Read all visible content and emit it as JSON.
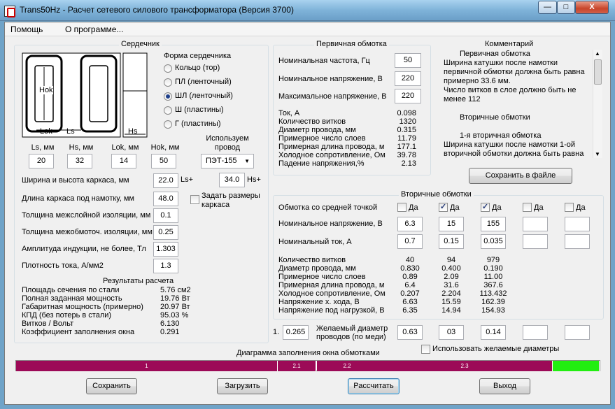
{
  "window": {
    "title": "Trans50Hz - Расчет сетевого силового трансформатора (Версия 3700)",
    "btn_min": "—",
    "btn_max": "□",
    "btn_close": "X"
  },
  "menu": {
    "help": "Помощь",
    "about": "О программе..."
  },
  "core": {
    "group_title": "Сердечник",
    "drawing": {
      "hok": "Hok",
      "lok": "Lok",
      "ls": "Ls",
      "hs": "Hs"
    },
    "shape_title": "Форма сердечника",
    "shapes": [
      {
        "label": "Кольцо  (тор)",
        "selected": false
      },
      {
        "label": "ПЛ  (ленточный)",
        "selected": false
      },
      {
        "label": "ШЛ  (ленточный)",
        "selected": true
      },
      {
        "label": "Ш  (пластины)",
        "selected": false
      },
      {
        "label": "Г (пластины)",
        "selected": false
      }
    ],
    "dims": [
      {
        "label": "Ls, мм",
        "value": "20"
      },
      {
        "label": "Hs, мм",
        "value": "32"
      },
      {
        "label": "Lok, мм",
        "value": "14"
      },
      {
        "label": "Hok, мм",
        "value": "50"
      }
    ],
    "wire_label": "Используем провод",
    "wire_value": "ПЭТ-155",
    "params": [
      {
        "label": "Ширина и высота каркаса, мм",
        "value": "22.0"
      },
      {
        "label": "Длина каркаса под намотку, мм",
        "value": "48.0"
      },
      {
        "label": "Толщина межслойной изоляции, мм",
        "value": "0.1"
      },
      {
        "label": "Толщина межобмоточ. изоляции, мм",
        "value": "0.25"
      },
      {
        "label": "Амплитуда индукции, не более, Тл",
        "value": "1.303"
      },
      {
        "label": "Плотность тока, А/мм2",
        "value": "1.3"
      }
    ],
    "ls_plus": "Ls+",
    "hs_value": "34.0",
    "hs_plus": "Hs+",
    "set_frame_label": "Задать размеры каркаса",
    "results_title": "Результаты расчета",
    "results": [
      {
        "label": "Площадь сечения по стали",
        "value": "5.76 см2"
      },
      {
        "label": "Полная заданная мощность",
        "value": "19.76 Вт"
      },
      {
        "label": "Габаритная мощность (примерно)",
        "value": "20.97 Вт"
      },
      {
        "label": "КПД (без потерь в стали)",
        "value": "95.03 %"
      },
      {
        "label": "Витков / Вольт",
        "value": "6.130"
      },
      {
        "label": "Коэффициент заполнения окна",
        "value": "0.291"
      }
    ]
  },
  "primary": {
    "group_title": "Первичная обмотка",
    "inputs": [
      {
        "label": "Номинальная частота, Гц",
        "value": "50"
      },
      {
        "label": "Номинальное напряжение, В",
        "value": "220"
      },
      {
        "label": "Максимальное напряжение, В",
        "value": "220"
      }
    ],
    "results": [
      {
        "label": "Ток, А",
        "value": "0.098"
      },
      {
        "label": "Количество витков",
        "value": "1320"
      },
      {
        "label": "Диаметр провода, мм",
        "value": "0.315"
      },
      {
        "label": "Примерное число слоев",
        "value": "11.79"
      },
      {
        "label": "Примерная длина провода, м",
        "value": "177.1"
      },
      {
        "label": "Холодное сопротивление, Ом",
        "value": "39.78"
      },
      {
        "label": "Падение напряжения,%",
        "value": "2.13"
      }
    ]
  },
  "comment": {
    "title": "Комментарий",
    "lines": [
      "Первичная обмотка",
      "Ширина катушки после намотки",
      "первичной обмотки должна быть равна",
      "примерно 33.6 мм.",
      "Число витков в слое должно быть не",
      "менее 112",
      "",
      "Вторичные обмотки",
      "",
      "1-я вторичная обмотка",
      "Ширина катушки после намотки 1-ой",
      "вторичной обмотки должна быть равна"
    ],
    "save_button": "Сохранить в файле"
  },
  "secondary": {
    "group_title": "Вторичные обмотки",
    "center_tap_label": "Обмотка со средней точкой",
    "yes": "Да",
    "columns": [
      {
        "tap": false,
        "voltage": "6.3",
        "current": "0.7",
        "desired": "0.63",
        "turns": "40",
        "diam": "0.830",
        "layers": "0.89",
        "length": "6.4",
        "resistance": "0.207",
        "open_v": "6.63",
        "load_v": "6.35"
      },
      {
        "tap": true,
        "voltage": "15",
        "current": "0.15",
        "desired": "03",
        "turns": "94",
        "diam": "0.400",
        "layers": "2.09",
        "length": "31.6",
        "resistance": "2.204",
        "open_v": "15.59",
        "load_v": "14.94"
      },
      {
        "tap": true,
        "voltage": "155",
        "current": "0.035",
        "desired": "0.14",
        "turns": "979",
        "diam": "0.190",
        "layers": "11.00",
        "length": "367.6",
        "resistance": "113.432",
        "open_v": "162.39",
        "load_v": "154.93"
      },
      {
        "tap": false,
        "voltage": "",
        "current": "",
        "desired": "",
        "turns": "",
        "diam": "",
        "layers": "",
        "length": "",
        "resistance": "",
        "open_v": "",
        "load_v": ""
      },
      {
        "tap": false,
        "voltage": "",
        "current": "",
        "desired": "",
        "turns": "",
        "diam": "",
        "layers": "",
        "length": "",
        "resistance": "",
        "open_v": "",
        "load_v": ""
      }
    ],
    "voltage_label": "Номинальное напряжение, В",
    "current_label": "Номинальный ток, А",
    "result_labels": [
      "Количество витков",
      "Диаметр провода, мм",
      "Примерное число слоев",
      "Примерная длина провода, м",
      "Холодное сопротивление, Ом",
      "Напряжение х. хода, В",
      "Напряжение под нагрузкой, В"
    ],
    "desired_prefix": "1.",
    "desired_first": "0.265",
    "desired_label": "Желаемый диаметр проводов  (по меди)",
    "use_desired_label": "Использовать желаемые диаметры"
  },
  "fill_diagram": {
    "title": "Диаграмма заполнения окна обмотками",
    "segments": [
      {
        "label": "1",
        "fraction": 0.449,
        "color": "#9c0a57"
      },
      {
        "label": "2.1",
        "fraction": 0.066,
        "color": "#9c0a57"
      },
      {
        "label": "2.2",
        "fraction": 0.104,
        "color": "#9c0a57"
      },
      {
        "label": "2.3",
        "fraction": 0.301,
        "color": "#9c0a57"
      },
      {
        "label": "",
        "fraction": 0.08,
        "color": "#22ee11"
      }
    ]
  },
  "buttons": {
    "save": "Сохранить",
    "load": "Загрузить",
    "calc": "Рассчитать",
    "exit": "Выход"
  }
}
